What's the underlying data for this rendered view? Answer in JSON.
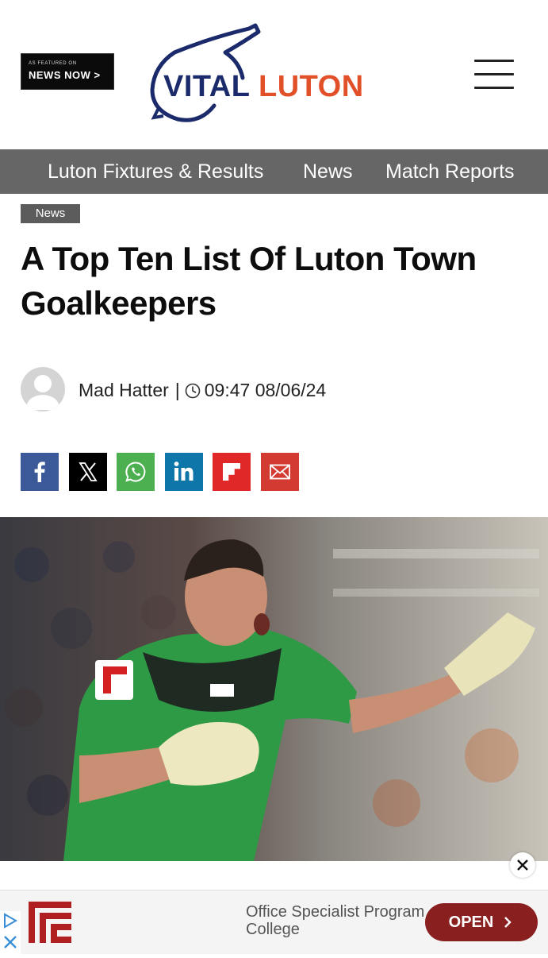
{
  "header": {
    "badge_small": "AS FEATURED ON",
    "badge_big": "NEWS NOW >",
    "logo_vital": "VITAL",
    "logo_luton": "LUTON",
    "menu_icon": "hamburger-menu-icon"
  },
  "nav": {
    "items": [
      {
        "label": "Luton Fixtures & Results"
      },
      {
        "label": "News"
      },
      {
        "label": "Match Reports"
      }
    ]
  },
  "article": {
    "category": "News",
    "title": "A Top Ten List Of Luton Town Goalkeepers",
    "author": "Mad Hatter",
    "separator": "|",
    "timestamp": "09:47 08/06/24",
    "hero_image_icon": "goalkeeper-photo"
  },
  "share": {
    "buttons": [
      {
        "name": "facebook",
        "color": "#3b5998"
      },
      {
        "name": "x",
        "color": "#000000"
      },
      {
        "name": "whatsapp",
        "color": "#4caf50"
      },
      {
        "name": "linkedin",
        "color": "#0e76a8"
      },
      {
        "name": "flipboard",
        "color": "#e12828"
      },
      {
        "name": "email",
        "color": "#d33b32"
      }
    ]
  },
  "ad": {
    "text_line1": "Office Specialist Program",
    "text_line2": "College",
    "button_label": "OPEN",
    "brand_color": "#8a1f1f"
  }
}
